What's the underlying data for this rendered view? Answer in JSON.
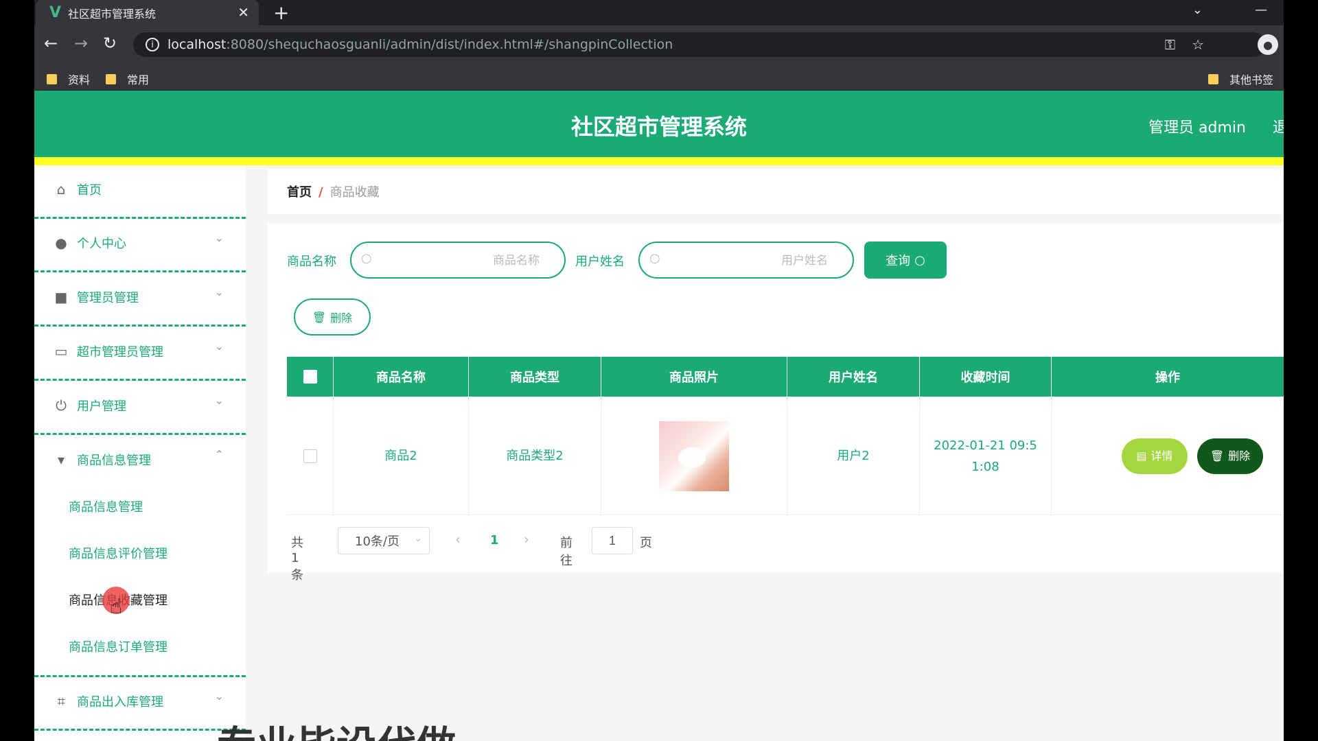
{
  "browser": {
    "tab_title": "社区超市管理系统",
    "url_host": "localhost",
    "url_rest": ":8080/shequchaosguanli/admin/dist/index.html#/shangpinCollection",
    "bookmarks": [
      "资料",
      "常用"
    ],
    "other_bookmarks": "其他书签"
  },
  "header": {
    "title": "社区超市管理系统",
    "admin_label": "管理员 admin",
    "logout_label": "退"
  },
  "sidebar": {
    "items": [
      {
        "label": "首页",
        "icon": "home-icon"
      },
      {
        "label": "个人中心",
        "icon": "user-icon"
      },
      {
        "label": "管理员管理",
        "icon": "admin-icon"
      },
      {
        "label": "超市管理员管理",
        "icon": "id-card-icon"
      },
      {
        "label": "用户管理",
        "icon": "power-icon"
      },
      {
        "label": "商品信息管理",
        "icon": "goods-icon"
      },
      {
        "label": "商品出入库管理",
        "icon": "crop-icon"
      }
    ],
    "sub_items": [
      "商品信息管理",
      "商品信息评价管理",
      "商品信息收藏管理",
      "商品信息订单管理"
    ]
  },
  "breadcrumb": {
    "home": "首页",
    "separator": "/",
    "current": "商品收藏"
  },
  "filters": {
    "product_label": "商品名称",
    "product_placeholder": "商品名称",
    "user_label": "用户姓名",
    "user_placeholder": "用户姓名",
    "search_button": "查询"
  },
  "toolbar": {
    "delete_label": "删除"
  },
  "table": {
    "columns": [
      "商品名称",
      "商品类型",
      "商品照片",
      "用户姓名",
      "收藏时间",
      "操作"
    ],
    "rows": [
      {
        "product_name": "商品2",
        "product_type": "商品类型2",
        "user_name": "用户2",
        "time_line1": "2022-01-21 09:5",
        "time_line2": "1:08",
        "detail_label": "详情",
        "delete_label": "删除"
      }
    ]
  },
  "pagination": {
    "total": "共 1 条",
    "page_size": "10条/页",
    "current_page": "1",
    "goto_prefix": "前往",
    "goto_value": "1",
    "goto_suffix": "页"
  },
  "overlay": {
    "text": "专业毕设代做"
  },
  "colors": {
    "primary": "#1ba975",
    "header_stripe": "#ffff26",
    "detail_button": "#a5d63f",
    "delete_button": "#11581c"
  }
}
